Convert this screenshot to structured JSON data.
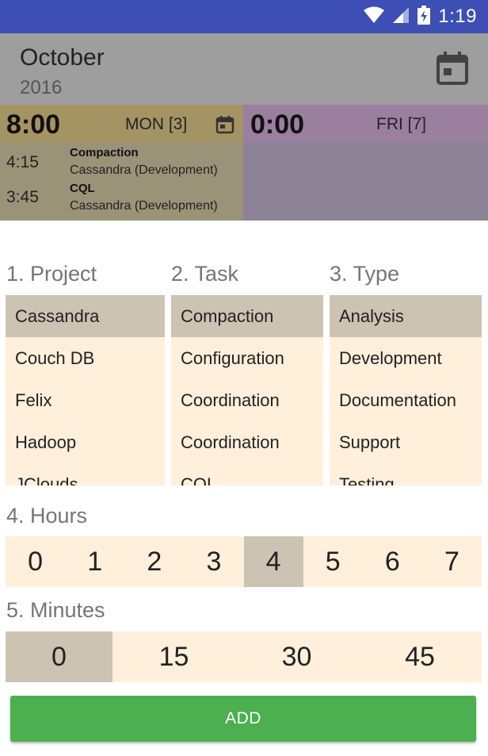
{
  "status_bar": {
    "time": "1:19"
  },
  "header": {
    "month": "October",
    "year": "2016"
  },
  "days": [
    {
      "total": "8:00",
      "day_label": "MON [3]",
      "entries": [
        {
          "time": "4:15",
          "task": "Compaction",
          "project": "Cassandra (Development)"
        },
        {
          "time": "3:45",
          "task": "CQL",
          "project": "Cassandra (Development)"
        }
      ]
    },
    {
      "total": "0:00",
      "day_label": "FRI [7]",
      "entries": []
    }
  ],
  "project": {
    "label": "1. Project",
    "items": [
      "Cassandra",
      "Couch DB",
      "Felix",
      "Hadoop",
      "JClouds"
    ],
    "selected": "Cassandra"
  },
  "task": {
    "label": "2. Task",
    "items": [
      "Compaction",
      "Configuration",
      "Coordination",
      "Coordination",
      "CQL"
    ],
    "selected": "Compaction"
  },
  "type": {
    "label": "3. Type",
    "items": [
      "Analysis",
      "Development",
      "Documentation",
      "Support",
      "Testing"
    ],
    "selected": "Analysis"
  },
  "hours": {
    "label": "4. Hours",
    "values": [
      "0",
      "1",
      "2",
      "3",
      "4",
      "5",
      "6",
      "7"
    ],
    "selected": "4"
  },
  "minutes": {
    "label": "5. Minutes",
    "values": [
      "0",
      "15",
      "30",
      "45"
    ],
    "selected": "0"
  },
  "add_button": {
    "label": "ADD"
  },
  "colors": {
    "status_bar": "#3d4fb5",
    "list_bg": "#ffefdb",
    "selected_bg": "#cdc3b3",
    "add_button": "#4caf50"
  }
}
